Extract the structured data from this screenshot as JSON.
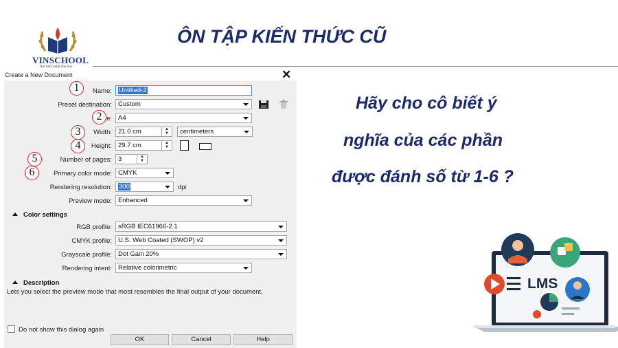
{
  "slide": {
    "title": "ÔN TẬP KIẾN THỨC CŨ",
    "logo_name": "VINSCHOOL",
    "logo_tagline": "Nơi ươm mầm tinh hoa",
    "question_lines": [
      "Hãy cho cô biết ý",
      "nghĩa của các phần",
      "được đánh số từ 1-6 ?"
    ],
    "illustration_label": "LMS"
  },
  "dialog": {
    "title": "Create a New Document",
    "name_label": "Name:",
    "name_value": "Untitled-2",
    "preset_label": "Preset destination:",
    "preset_value": "Custom",
    "size_label": "Size:",
    "size_value": "A4",
    "width_label": "Width:",
    "width_value": "21.0 cm",
    "units_value": "centimeters",
    "height_label": "Height:",
    "height_value": "29.7 cm",
    "pages_label": "Number of pages:",
    "pages_value": "3",
    "color_mode_label": "Primary color mode:",
    "color_mode_value": "CMYK",
    "resolution_label": "Rendering resolution:",
    "resolution_value": "300",
    "resolution_unit": "dpi",
    "preview_label": "Preview mode:",
    "preview_value": "Enhanced",
    "color_settings_header": "Color settings",
    "rgb_label": "RGB profile:",
    "rgb_value": "sRGB IEC61966-2.1",
    "cmyk_label": "CMYK profile:",
    "cmyk_value": "U.S. Web Coated (SWOP) v2",
    "grayscale_label": "Grayscale profile:",
    "grayscale_value": "Dot Gain 20%",
    "intent_label": "Rendering intent:",
    "intent_value": "Relative colorimetric",
    "description_header": "Description",
    "description_text": "Lets you select the preview mode that most resembles the final output of your document.",
    "dont_show_label": "Do not show this dialog again",
    "ok_label": "OK",
    "cancel_label": "Cancel",
    "help_label": "Help"
  },
  "markers": [
    "1",
    "2",
    "3",
    "4",
    "5",
    "6"
  ],
  "colors": {
    "title_blue": "#1b2a6b",
    "marker_red": "#d81f1f",
    "selection_blue": "#3576d1"
  }
}
